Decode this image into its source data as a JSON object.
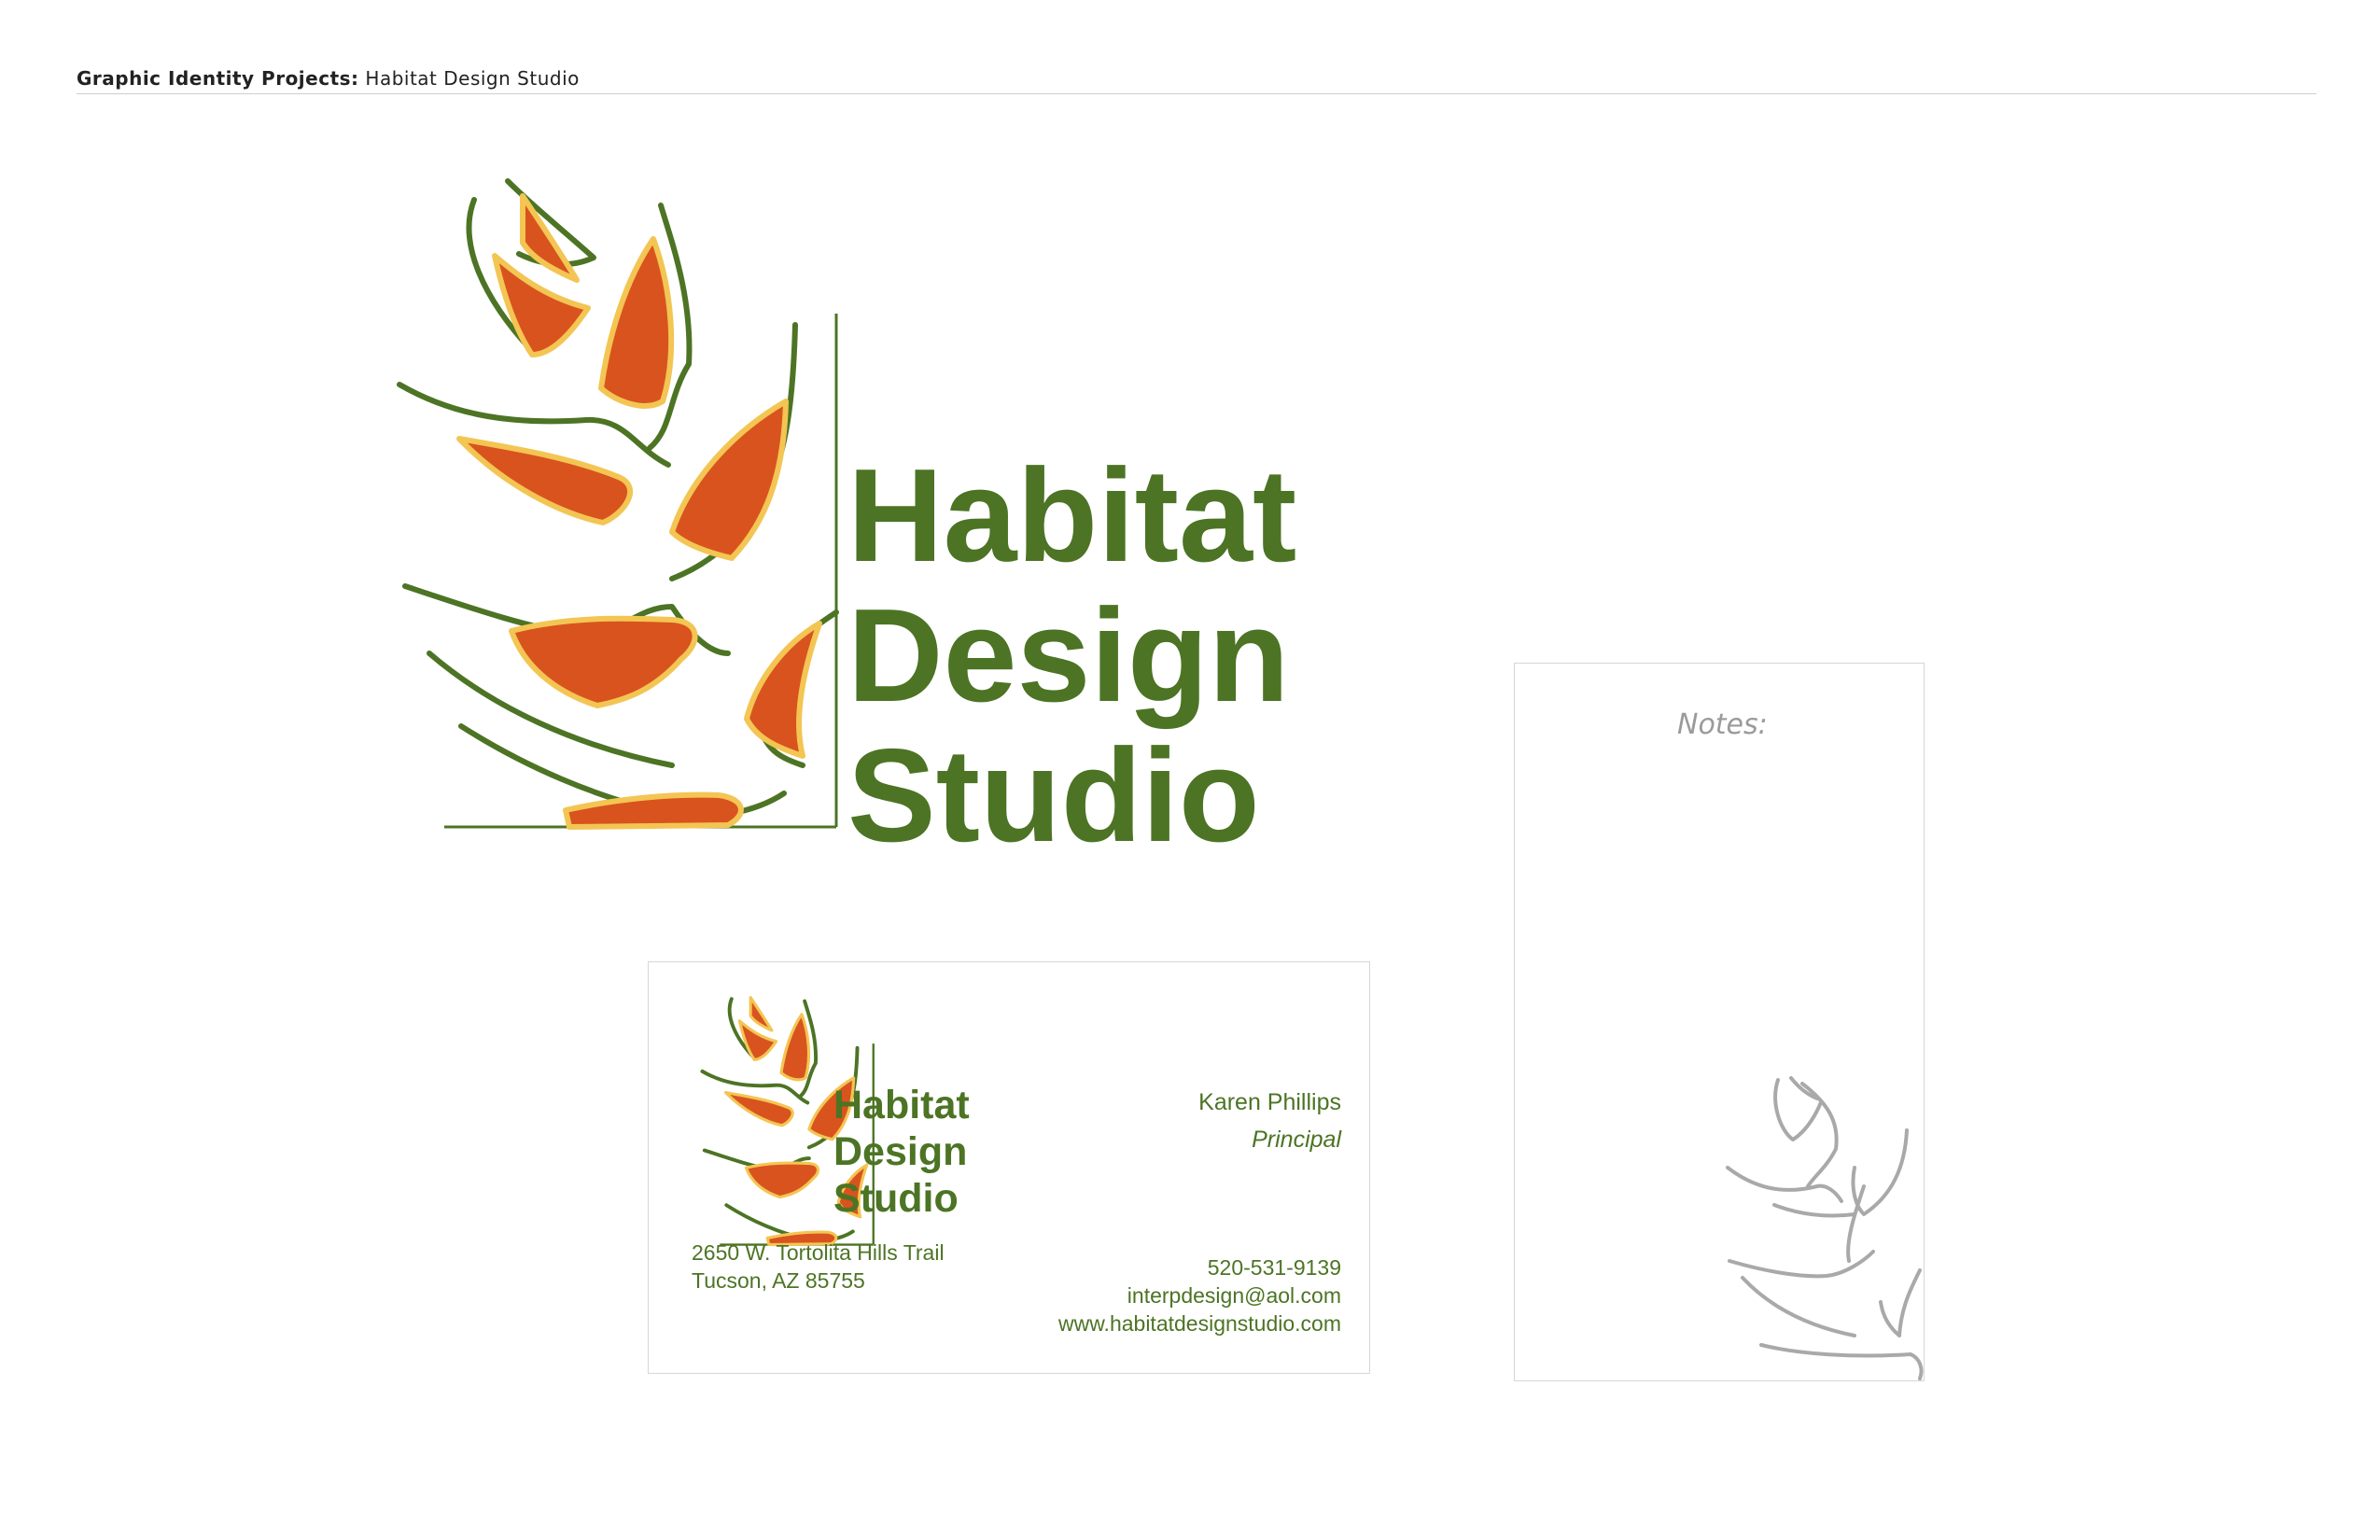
{
  "header": {
    "prefix": "Graphic Identity Projects:",
    "title": "Habitat Design Studio"
  },
  "logo": {
    "line1": "Habitat",
    "line2": "Design",
    "line3": "Studio",
    "colors": {
      "green": "#4c7424",
      "orange": "#d9531e",
      "yellow": "#f3c553"
    }
  },
  "business_card": {
    "logo_line1": "Habitat",
    "logo_line2": "Design",
    "logo_line3": "Studio",
    "name": "Karen Phillips",
    "title": "Principal",
    "address_line1": "2650 W. Tortolita Hills Trail",
    "address_line2": "Tucson, AZ 85755",
    "phone": "520-531-9139",
    "email": "interpdesign@aol.com",
    "website": "www.habitatdesignstudio.com"
  },
  "notepad": {
    "label": "Notes:",
    "watermark_color": "#a9a9a9"
  }
}
